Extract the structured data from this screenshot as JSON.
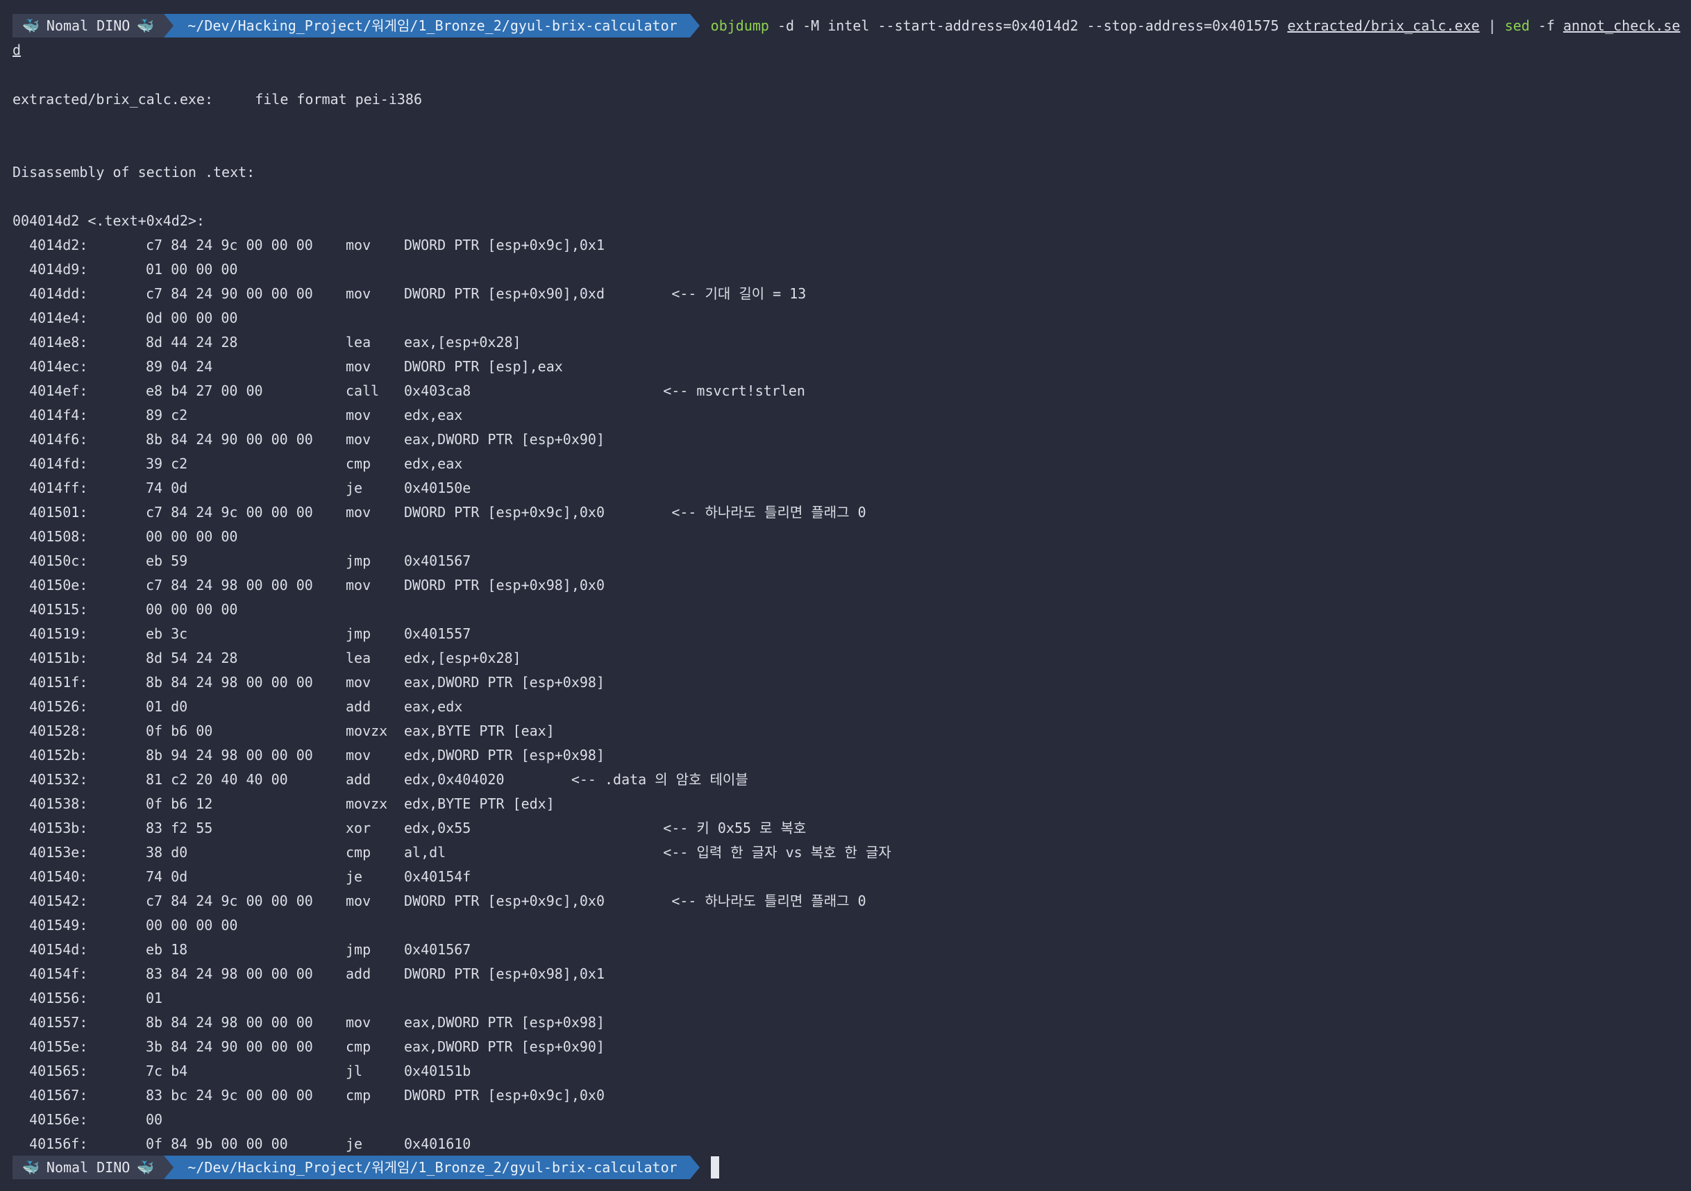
{
  "prompt": {
    "user": "Nomal DINO",
    "whale_left": "🐳",
    "whale_right": "🐳",
    "path": "~/Dev/Hacking_Project/워게임/1_Bronze_2/gyul-brix-calculator",
    "colors": {
      "user_bg": "#3a3f52",
      "path_bg": "#2f6fb3",
      "green": "#8fd14f",
      "bg": "#272b3a"
    }
  },
  "command": {
    "prog": "objdump",
    "args1": " -d -M intel --start-address=0x4014d2 --stop-address=0x401575 ",
    "file": "extracted/brix_calc.exe",
    "pipe": " | ",
    "sed": "sed",
    "args2": " -f ",
    "script_a": "annot_check.se",
    "script_b": "d"
  },
  "output": {
    "file_format": "extracted/brix_calc.exe:     file format pei-i386",
    "section": "Disassembly of section .text:",
    "label": "004014d2 <.text+0x4d2>:"
  },
  "asm": [
    {
      "addr": "  4014d2:",
      "bytes": "c7 84 24 9c 00 00 00",
      "mn": "mov",
      "op": "DWORD PTR [esp+0x9c],0x1",
      "cm": ""
    },
    {
      "addr": "  4014d9:",
      "bytes": "01 00 00 00",
      "mn": "",
      "op": "",
      "cm": ""
    },
    {
      "addr": "  4014dd:",
      "bytes": "c7 84 24 90 00 00 00",
      "mn": "mov",
      "op": "DWORD PTR [esp+0x90],0xd",
      "cm": "        <-- 기대 길이 = 13"
    },
    {
      "addr": "  4014e4:",
      "bytes": "0d 00 00 00",
      "mn": "",
      "op": "",
      "cm": ""
    },
    {
      "addr": "  4014e8:",
      "bytes": "8d 44 24 28",
      "mn": "lea",
      "op": "eax,[esp+0x28]",
      "cm": ""
    },
    {
      "addr": "  4014ec:",
      "bytes": "89 04 24",
      "mn": "mov",
      "op": "DWORD PTR [esp],eax",
      "cm": ""
    },
    {
      "addr": "  4014ef:",
      "bytes": "e8 b4 27 00 00",
      "mn": "call",
      "op": "0x403ca8",
      "cm": "                       <-- msvcrt!strlen"
    },
    {
      "addr": "  4014f4:",
      "bytes": "89 c2",
      "mn": "mov",
      "op": "edx,eax",
      "cm": ""
    },
    {
      "addr": "  4014f6:",
      "bytes": "8b 84 24 90 00 00 00",
      "mn": "mov",
      "op": "eax,DWORD PTR [esp+0x90]",
      "cm": ""
    },
    {
      "addr": "  4014fd:",
      "bytes": "39 c2",
      "mn": "cmp",
      "op": "edx,eax",
      "cm": ""
    },
    {
      "addr": "  4014ff:",
      "bytes": "74 0d",
      "mn": "je",
      "op": "0x40150e",
      "cm": ""
    },
    {
      "addr": "  401501:",
      "bytes": "c7 84 24 9c 00 00 00",
      "mn": "mov",
      "op": "DWORD PTR [esp+0x9c],0x0",
      "cm": "        <-- 하나라도 틀리면 플래그 0"
    },
    {
      "addr": "  401508:",
      "bytes": "00 00 00 00",
      "mn": "",
      "op": "",
      "cm": ""
    },
    {
      "addr": "  40150c:",
      "bytes": "eb 59",
      "mn": "jmp",
      "op": "0x401567",
      "cm": ""
    },
    {
      "addr": "  40150e:",
      "bytes": "c7 84 24 98 00 00 00",
      "mn": "mov",
      "op": "DWORD PTR [esp+0x98],0x0",
      "cm": ""
    },
    {
      "addr": "  401515:",
      "bytes": "00 00 00 00",
      "mn": "",
      "op": "",
      "cm": ""
    },
    {
      "addr": "  401519:",
      "bytes": "eb 3c",
      "mn": "jmp",
      "op": "0x401557",
      "cm": ""
    },
    {
      "addr": "  40151b:",
      "bytes": "8d 54 24 28",
      "mn": "lea",
      "op": "edx,[esp+0x28]",
      "cm": ""
    },
    {
      "addr": "  40151f:",
      "bytes": "8b 84 24 98 00 00 00",
      "mn": "mov",
      "op": "eax,DWORD PTR [esp+0x98]",
      "cm": ""
    },
    {
      "addr": "  401526:",
      "bytes": "01 d0",
      "mn": "add",
      "op": "eax,edx",
      "cm": ""
    },
    {
      "addr": "  401528:",
      "bytes": "0f b6 00",
      "mn": "movzx",
      "op": "eax,BYTE PTR [eax]",
      "cm": ""
    },
    {
      "addr": "  40152b:",
      "bytes": "8b 94 24 98 00 00 00",
      "mn": "mov",
      "op": "edx,DWORD PTR [esp+0x98]",
      "cm": ""
    },
    {
      "addr": "  401532:",
      "bytes": "81 c2 20 40 40 00",
      "mn": "add",
      "op": "edx,0x404020",
      "cm": "        <-- .data 의 암호 테이블"
    },
    {
      "addr": "  401538:",
      "bytes": "0f b6 12",
      "mn": "movzx",
      "op": "edx,BYTE PTR [edx]",
      "cm": ""
    },
    {
      "addr": "  40153b:",
      "bytes": "83 f2 55",
      "mn": "xor",
      "op": "edx,0x55",
      "cm": "                       <-- 키 0x55 로 복호"
    },
    {
      "addr": "  40153e:",
      "bytes": "38 d0",
      "mn": "cmp",
      "op": "al,dl",
      "cm": "                          <-- 입력 한 글자 vs 복호 한 글자"
    },
    {
      "addr": "  401540:",
      "bytes": "74 0d",
      "mn": "je",
      "op": "0x40154f",
      "cm": ""
    },
    {
      "addr": "  401542:",
      "bytes": "c7 84 24 9c 00 00 00",
      "mn": "mov",
      "op": "DWORD PTR [esp+0x9c],0x0",
      "cm": "        <-- 하나라도 틀리면 플래그 0"
    },
    {
      "addr": "  401549:",
      "bytes": "00 00 00 00",
      "mn": "",
      "op": "",
      "cm": ""
    },
    {
      "addr": "  40154d:",
      "bytes": "eb 18",
      "mn": "jmp",
      "op": "0x401567",
      "cm": ""
    },
    {
      "addr": "  40154f:",
      "bytes": "83 84 24 98 00 00 00",
      "mn": "add",
      "op": "DWORD PTR [esp+0x98],0x1",
      "cm": ""
    },
    {
      "addr": "  401556:",
      "bytes": "01",
      "mn": "",
      "op": "",
      "cm": ""
    },
    {
      "addr": "  401557:",
      "bytes": "8b 84 24 98 00 00 00",
      "mn": "mov",
      "op": "eax,DWORD PTR [esp+0x98]",
      "cm": ""
    },
    {
      "addr": "  40155e:",
      "bytes": "3b 84 24 90 00 00 00",
      "mn": "cmp",
      "op": "eax,DWORD PTR [esp+0x90]",
      "cm": ""
    },
    {
      "addr": "  401565:",
      "bytes": "7c b4",
      "mn": "jl",
      "op": "0x40151b",
      "cm": ""
    },
    {
      "addr": "  401567:",
      "bytes": "83 bc 24 9c 00 00 00",
      "mn": "cmp",
      "op": "DWORD PTR [esp+0x9c],0x0",
      "cm": ""
    },
    {
      "addr": "  40156e:",
      "bytes": "00",
      "mn": "",
      "op": "",
      "cm": ""
    },
    {
      "addr": "  40156f:",
      "bytes": "0f 84 9b 00 00 00",
      "mn": "je",
      "op": "0x401610",
      "cm": ""
    }
  ]
}
